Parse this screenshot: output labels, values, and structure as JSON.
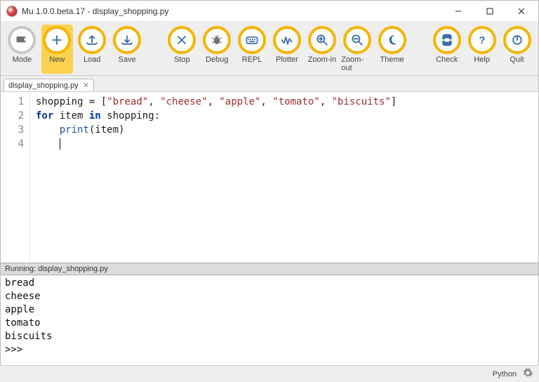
{
  "window": {
    "title": "Mu 1.0.0.beta.17 - display_shopping.py"
  },
  "toolbar": {
    "items": [
      {
        "id": "mode",
        "label": "Mode"
      },
      {
        "id": "new",
        "label": "New"
      },
      {
        "id": "load",
        "label": "Load"
      },
      {
        "id": "save",
        "label": "Save"
      },
      {
        "id": "stop",
        "label": "Stop"
      },
      {
        "id": "debug",
        "label": "Debug"
      },
      {
        "id": "repl",
        "label": "REPL"
      },
      {
        "id": "plotter",
        "label": "Plotter"
      },
      {
        "id": "zoomin",
        "label": "Zoom-in"
      },
      {
        "id": "zoomout",
        "label": "Zoom-out"
      },
      {
        "id": "theme",
        "label": "Theme"
      },
      {
        "id": "check",
        "label": "Check"
      },
      {
        "id": "help",
        "label": "Help"
      },
      {
        "id": "quit",
        "label": "Quit"
      }
    ]
  },
  "tabs": {
    "active": "display_shopping.py"
  },
  "editor": {
    "line_numbers": [
      "1",
      "2",
      "3",
      "4"
    ],
    "tokens": [
      [
        [
          "plain",
          "shopping "
        ],
        [
          "op",
          "="
        ],
        [
          "plain",
          " "
        ],
        [
          "op",
          "["
        ],
        [
          "str",
          "\"bread\""
        ],
        [
          "op",
          ","
        ],
        [
          "plain",
          " "
        ],
        [
          "str",
          "\"cheese\""
        ],
        [
          "op",
          ","
        ],
        [
          "plain",
          " "
        ],
        [
          "str",
          "\"apple\""
        ],
        [
          "op",
          ","
        ],
        [
          "plain",
          " "
        ],
        [
          "str",
          "\"tomato\""
        ],
        [
          "op",
          ","
        ],
        [
          "plain",
          " "
        ],
        [
          "str",
          "\"biscuits\""
        ],
        [
          "op",
          "]"
        ]
      ],
      [
        [
          "kw",
          "for"
        ],
        [
          "plain",
          " item "
        ],
        [
          "kw",
          "in"
        ],
        [
          "plain",
          " shopping"
        ],
        [
          "op",
          ":"
        ]
      ],
      [
        [
          "plain",
          "    "
        ],
        [
          "fn",
          "print"
        ],
        [
          "op",
          "("
        ],
        [
          "plain",
          "item"
        ],
        [
          "op",
          ")"
        ]
      ],
      [
        [
          "plain",
          "    "
        ]
      ]
    ]
  },
  "panel": {
    "header": "Running: display_shopping.py",
    "output_lines": [
      "bread",
      "cheese",
      "apple",
      "tomato",
      "biscuits",
      ">>>"
    ]
  },
  "status": {
    "mode": "Python"
  }
}
